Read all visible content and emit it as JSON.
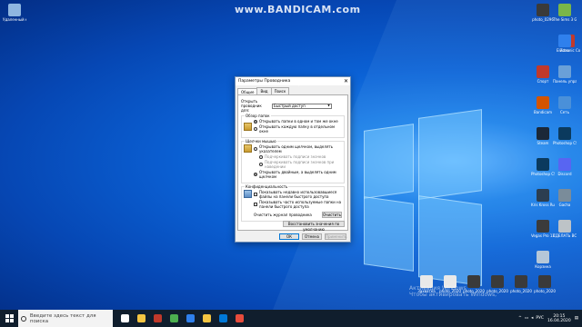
{
  "watermark": "www.BANDICAM.com",
  "desktop_icons_left": [
    {
      "label": "Удаленный клиент",
      "color": "#8fb6e0"
    }
  ],
  "desktop_icons_right": [
    {
      "label": "photo_0296",
      "color": "#3a3a3a"
    },
    {
      "label": "The Sims 3 Gold E...",
      "color": "#7ab648"
    },
    {
      "label": "Electronic Сорок Со...",
      "color": "#c0392b"
    },
    {
      "label": "Zona",
      "color": "#2f80ed"
    },
    {
      "label": "Спорт",
      "color": "#c0392b"
    },
    {
      "label": "Панель управления",
      "color": "#6aa0d8"
    },
    {
      "label": "Bandicam",
      "color": "#d35400"
    },
    {
      "label": "Сеть",
      "color": "#4a90d9"
    },
    {
      "label": "Steam",
      "color": "#1b2838"
    },
    {
      "label": "Photoshop CS6",
      "color": "#0b3a5e"
    },
    {
      "label": "Photoshop CS6 x64",
      "color": "#0b3a5e"
    },
    {
      "label": "Discord",
      "color": "#5865f2"
    },
    {
      "label": "Kris Kross Ruck Sim",
      "color": "#2c3e50"
    },
    {
      "label": "Gacha",
      "color": "#7a8c9a"
    },
    {
      "label": "Vegas Pro 13.0 (64-bit)",
      "color": "#3b3b3b"
    },
    {
      "label": "СДЕЛАТЬ ВСЁ ДЕЛЯ",
      "color": "#bdc3c7"
    },
    {
      "label": "Корзина",
      "color": "#b5c7d8"
    }
  ],
  "desktop_icons_bottom": [
    {
      "label": "Захватка",
      "color": "#e9e9e9"
    },
    {
      "label": "photo_2020",
      "color": "#e9e9e9"
    },
    {
      "label": "photo_2020",
      "color": "#3a3a3a"
    },
    {
      "label": "photo_2020",
      "color": "#3a3a3a"
    },
    {
      "label": "photo_2020",
      "color": "#3a3a3a"
    },
    {
      "label": "photo_2020",
      "color": "#3a3a3a"
    }
  ],
  "windows_watermark": [
    "Активация Windows",
    "Чтобы активировать Windows,",
    "перейдите в раздел «Параметры»."
  ],
  "dialog": {
    "title": "Параметры Проводника",
    "close": "✕",
    "tabs": [
      "Общие",
      "Вид",
      "Поиск"
    ],
    "open_label": "Открыть проводник для:",
    "open_value": "Быстрый доступ",
    "browse_group": "Обзор папок",
    "browse_options": [
      "Открывать папки в одном и том же окне",
      "Открывать каждую папку в отдельном окне"
    ],
    "click_group": "Щелчки мышью",
    "click_options": [
      "Открывать одним щелчком, выделять указателем",
      "Подчеркивать подписи значков",
      "Подчеркивать подписи значков при наведении",
      "Открывать двойным, а выделять одним щелчком"
    ],
    "privacy_group": "Конфиденциальность",
    "privacy_options": [
      "Показывать недавно использовавшиеся файлы на панели быстрого доступа",
      "Показывать часто используемые папки на панели быстрого доступа"
    ],
    "clear_history_label": "Очистить журнал проводника",
    "clear_button": "Очистить",
    "restore_button": "Восстановить значения по умолчанию",
    "ok_button": "ОК",
    "cancel_button": "Отмена",
    "apply_button": "Применить"
  },
  "taskbar": {
    "search_placeholder": "Введите здесь текст для поиска",
    "time": "20:15",
    "date": "16.04.2020",
    "lang": "РУС",
    "apps": [
      {
        "name": "task-view",
        "color": "#ffffff"
      },
      {
        "name": "explorer",
        "color": "#f4c542"
      },
      {
        "name": "bandicam",
        "color": "#c0392b"
      },
      {
        "name": "chrome",
        "color": "#4caf50"
      },
      {
        "name": "photoshop",
        "color": "#2f80ed"
      },
      {
        "name": "folder",
        "color": "#f4c542"
      },
      {
        "name": "store",
        "color": "#0078d7"
      },
      {
        "name": "yandex",
        "color": "#e74c3c"
      }
    ]
  }
}
